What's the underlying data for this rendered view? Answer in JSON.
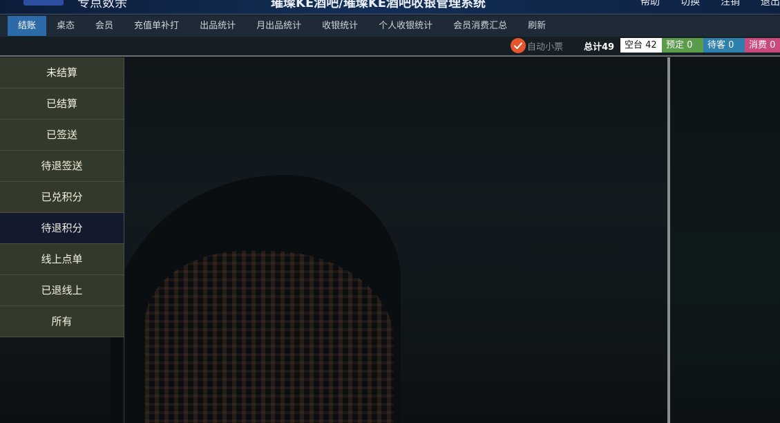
{
  "header": {
    "app_title": "专点数余",
    "store_title": "璀璨KE酒吧/璀璨KE酒吧收银管理系统",
    "links": [
      "帮助",
      "切换",
      "注销",
      "退出"
    ]
  },
  "menu": {
    "tabs": [
      {
        "label": "结账",
        "active": true
      },
      {
        "label": "桌态"
      },
      {
        "label": "会员"
      },
      {
        "label": "充值单补打"
      },
      {
        "label": "出品统计"
      },
      {
        "label": "月出品统计"
      },
      {
        "label": "收银统计"
      },
      {
        "label": "个人收银统计"
      },
      {
        "label": "会员消费汇总"
      },
      {
        "label": "刷新"
      }
    ]
  },
  "status": {
    "auto_ticket_label": "自动小票",
    "auto_ticket_checked": true,
    "total_label": "总计49",
    "badges": {
      "empty": "空台 42",
      "reserved": "预定 0",
      "waiting": "待客 0",
      "consume": "消费 0"
    },
    "colors": {
      "check": "#e4572e",
      "reserved": "#5b9b4c",
      "waiting": "#2f7fad",
      "consume": "#c84a7f",
      "active_tab": "#2d6aa8"
    }
  },
  "sidebar": {
    "items": [
      {
        "label": "未结算"
      },
      {
        "label": "已结算"
      },
      {
        "label": "已签送"
      },
      {
        "label": "待退签送"
      },
      {
        "label": "已兑积分"
      },
      {
        "label": "待退积分",
        "active": true
      },
      {
        "label": "线上点单"
      },
      {
        "label": "已退线上"
      },
      {
        "label": "所有"
      }
    ]
  }
}
